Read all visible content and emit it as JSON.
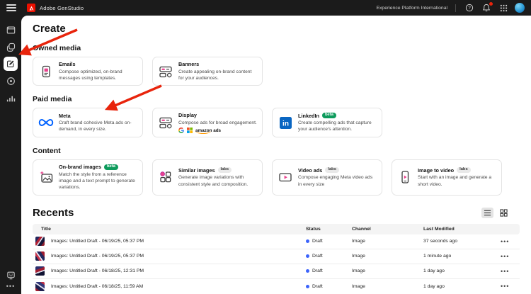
{
  "topbar": {
    "app_name": "Adobe GenStudio",
    "org_name": "Experience Platform International"
  },
  "sidebar": {
    "items": [
      {
        "icon": "overview-icon",
        "selected": false
      },
      {
        "icon": "assets-stack-icon",
        "selected": false
      },
      {
        "icon": "create-icon",
        "selected": true
      },
      {
        "icon": "activation-target-icon",
        "selected": false
      },
      {
        "icon": "insights-chart-icon",
        "selected": false
      }
    ],
    "bottom": [
      {
        "icon": "feedback-icon"
      },
      {
        "icon": "more-ellipsis"
      }
    ]
  },
  "main": {
    "title": "Create",
    "sections": [
      {
        "label": "Owned media",
        "cards": [
          {
            "title": "Emails",
            "badge": "",
            "icon": "email-template-icon",
            "description": "Compose optimized, on-brand messages using templates."
          },
          {
            "title": "Banners",
            "badge": "",
            "icon": "banner-icon",
            "description": "Create appealing on-brand content for your audiences."
          }
        ]
      },
      {
        "label": "Paid media",
        "cards": [
          {
            "title": "Meta",
            "badge": "",
            "icon": "meta-logo-icon",
            "description": "Craft brand cohesive Meta ads on-demand, in every size."
          },
          {
            "title": "Display",
            "badge": "",
            "icon": "banner-icon",
            "description": "Compose ads for broad engagement.",
            "logos": {
              "google": "google-logo",
              "microsoft": "microsoft-logo",
              "amazon": "amazon ads"
            }
          },
          {
            "title": "LinkedIn",
            "badge": "beta",
            "icon": "linkedin-logo-icon",
            "description": "Create compelling ads that capture your audience's attention."
          }
        ]
      },
      {
        "label": "Content",
        "cards": [
          {
            "title": "On-brand images",
            "badge": "beta",
            "icon": "on-brand-image-icon",
            "description": "Match the style from a reference image and a text prompt to generate variations."
          },
          {
            "title": "Similar images",
            "badge": "labs",
            "icon": "similar-images-icon",
            "description": "Generate image variations with consistent style and composition."
          },
          {
            "title": "Video ads",
            "badge": "labs",
            "icon": "video-ads-icon",
            "description": "Compose engaging Meta video ads in every size"
          },
          {
            "title": "Image to video",
            "badge": "labs",
            "icon": "image-to-video-icon",
            "description": "Start with an image and generate a short video."
          }
        ]
      }
    ]
  },
  "recents": {
    "title": "Recents",
    "columns": {
      "title": "Title",
      "status": "Status",
      "channel": "Channel",
      "modified": "Last Modified"
    },
    "rows": [
      {
        "title": "Images: Untitled Draft - 06/19/25, 05:37 PM",
        "status": "Draft",
        "channel": "Image",
        "modified": "37 seconds ago"
      },
      {
        "title": "Images: Untitled Draft - 06/19/25, 05:37 PM",
        "status": "Draft",
        "channel": "Image",
        "modified": "1 minute ago"
      },
      {
        "title": "Images: Untitled Draft - 06/18/25, 12:31 PM",
        "status": "Draft",
        "channel": "Image",
        "modified": "1 day ago"
      },
      {
        "title": "Images: Untitled Draft - 06/18/25, 11:59 AM",
        "status": "Draft",
        "channel": "Image",
        "modified": "1 day ago"
      }
    ]
  },
  "colors": {
    "adobe_red": "#eb1000",
    "arrow_red": "#e8240c",
    "draft_status_blue": "#3b63fb",
    "beta_badge_green": "#0d9b5c",
    "meta_blue": "#0866ff",
    "linkedin_blue": "#0a66c2",
    "card_accent_pink": "#e9418e"
  }
}
